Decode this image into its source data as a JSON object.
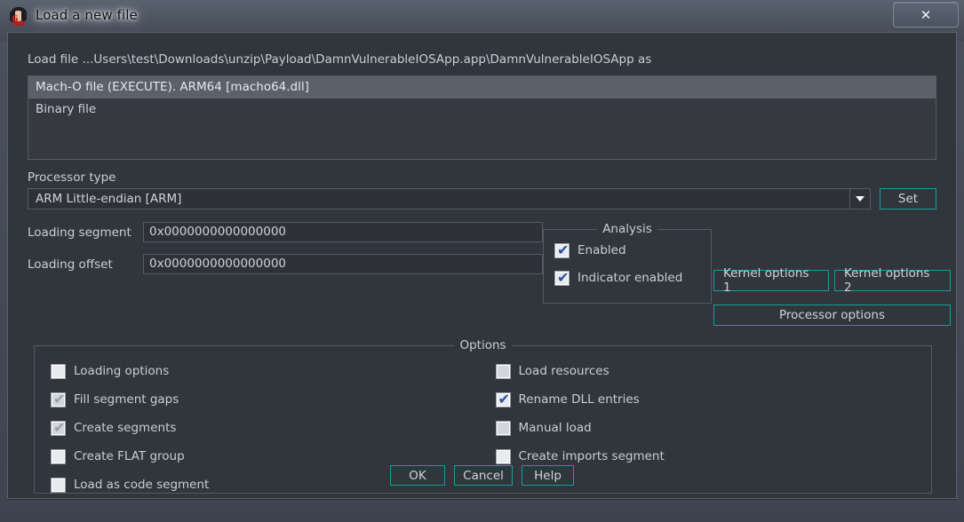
{
  "window": {
    "title": "Load a new file",
    "icon": "ida-pro-icon",
    "close_label": "✕"
  },
  "file_prompt": "Load file ...Users\\test\\Downloads\\unzip\\Payload\\DamnVulnerableIOSApp.app\\DamnVulnerableIOSApp as",
  "filetypes": [
    {
      "label": "Mach-O file (EXECUTE). ARM64 [macho64.dll]",
      "selected": true
    },
    {
      "label": "Binary file",
      "selected": false
    }
  ],
  "processor": {
    "label": "Processor type",
    "value": "ARM Little-endian [ARM]",
    "set_button": "Set",
    "dropdown_icon": "chevron-down-icon"
  },
  "loading": {
    "segment_label": "Loading segment",
    "segment_value": "0x0000000000000000",
    "offset_label": "Loading offset",
    "offset_value": "0x0000000000000000"
  },
  "analysis": {
    "legend": "Analysis",
    "items": [
      {
        "label": "Enabled",
        "checked": true,
        "enabled": true
      },
      {
        "label": "Indicator enabled",
        "checked": true,
        "enabled": true
      }
    ]
  },
  "side_buttons": {
    "kernel1": "Kernel options 1",
    "kernel2": "Kernel options 2",
    "processor_options": "Processor options"
  },
  "options": {
    "legend": "Options",
    "left": [
      {
        "label": "Loading options",
        "checked": false,
        "enabled": true
      },
      {
        "label": "Fill segment gaps",
        "checked": true,
        "enabled": false
      },
      {
        "label": "Create segments",
        "checked": true,
        "enabled": false
      },
      {
        "label": "Create FLAT group",
        "checked": false,
        "enabled": true
      },
      {
        "label": "Load as code segment",
        "checked": false,
        "enabled": true
      }
    ],
    "right": [
      {
        "label": "Load resources",
        "checked": false,
        "enabled": false
      },
      {
        "label": "Rename DLL entries",
        "checked": true,
        "enabled": true
      },
      {
        "label": "Manual load",
        "checked": false,
        "enabled": false
      },
      {
        "label": "Create imports segment",
        "checked": false,
        "enabled": true
      }
    ]
  },
  "footer": {
    "ok": "OK",
    "cancel": "Cancel",
    "help": "Help"
  },
  "colors": {
    "accent_border": "#1b9b9b",
    "dialog_bg": "#31353c",
    "titlebar_bg": "#4a515d",
    "selection_bg": "#5c6169",
    "check_blue": "#2d4f9e"
  }
}
